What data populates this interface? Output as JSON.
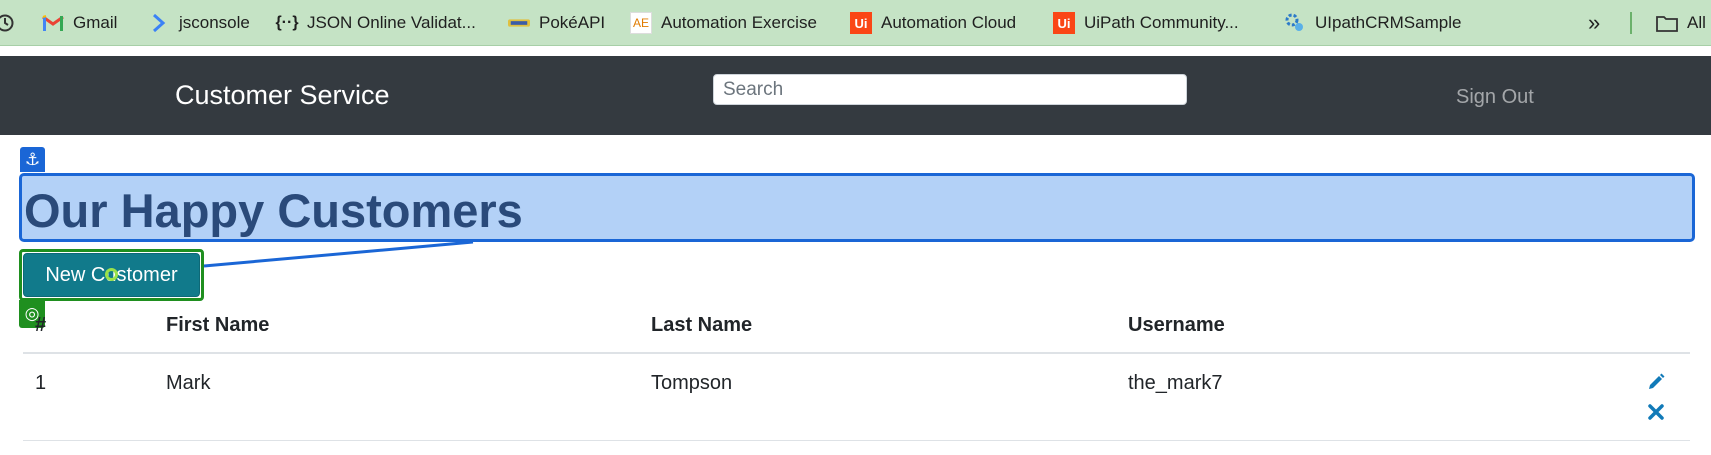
{
  "bookmarks": {
    "items": [
      {
        "label": "Gmail",
        "icon": "gmail-icon"
      },
      {
        "label": "jsconsole",
        "icon": "chevron-right-icon"
      },
      {
        "label": "JSON Online Validat...",
        "icon": "json-braces-icon"
      },
      {
        "label": "PokéAPI",
        "icon": "pokeapi-icon"
      },
      {
        "label": "Automation Exercise",
        "icon": "automation-exercise-icon"
      },
      {
        "label": "Automation Cloud",
        "icon": "uipath-icon"
      },
      {
        "label": "UiPath Community...",
        "icon": "uipath-icon"
      },
      {
        "label": "UIpathCRMSample",
        "icon": "gear-cloud-icon"
      }
    ],
    "overflow_label": "»",
    "all_label": "All"
  },
  "navbar": {
    "brand": "Customer Service",
    "search_placeholder": "Search",
    "signout": "Sign Out"
  },
  "page": {
    "heading": "Our Happy Customers",
    "new_customer_button": "New Customer"
  },
  "table": {
    "columns": [
      "#",
      "First Name",
      "Last Name",
      "Username"
    ],
    "rows": [
      {
        "id": "1",
        "first": "Mark",
        "last": "Tompson",
        "username": "the_mark7"
      }
    ]
  },
  "colors": {
    "bookmarks_bg": "#c5e3c5",
    "navbar_bg": "#343a40",
    "button_bg": "#117a8b",
    "anchor_highlight": "#1a66d6",
    "target_highlight": "#1f8f1f",
    "action_icon": "#117ab8"
  }
}
